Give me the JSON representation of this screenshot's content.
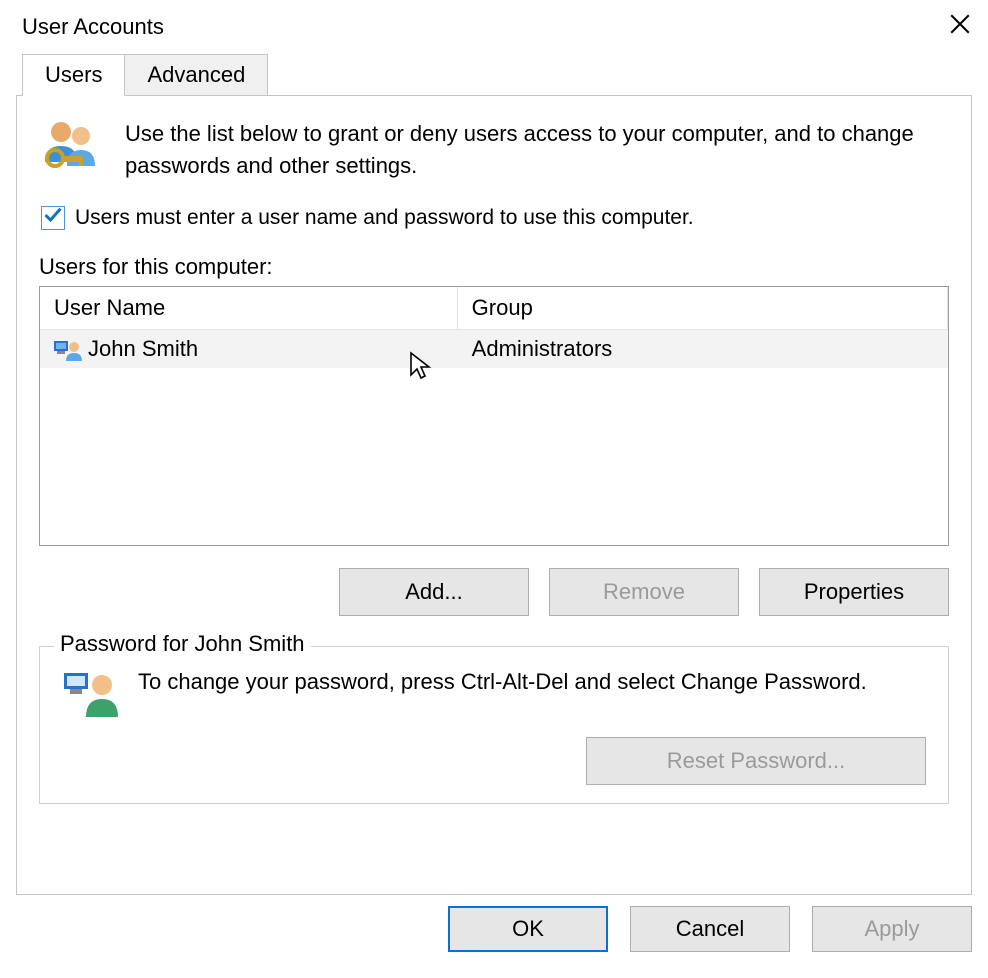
{
  "window": {
    "title": "User Accounts"
  },
  "tabs": {
    "users": "Users",
    "advanced": "Advanced"
  },
  "intro": "Use the list below to grant or deny users access to your computer, and to change passwords and other settings.",
  "checkbox_label": "Users must enter a user name and password to use this computer.",
  "list_label": "Users for this computer:",
  "columns": {
    "username": "User Name",
    "group": "Group"
  },
  "users": [
    {
      "name": "John Smith",
      "group": "Administrators"
    }
  ],
  "buttons": {
    "add": "Add...",
    "remove": "Remove",
    "properties": "Properties",
    "reset_password": "Reset Password...",
    "ok": "OK",
    "cancel": "Cancel",
    "apply": "Apply"
  },
  "password_box": {
    "legend": "Password for John Smith",
    "text": "To change your password, press Ctrl-Alt-Del and select Change Password."
  }
}
